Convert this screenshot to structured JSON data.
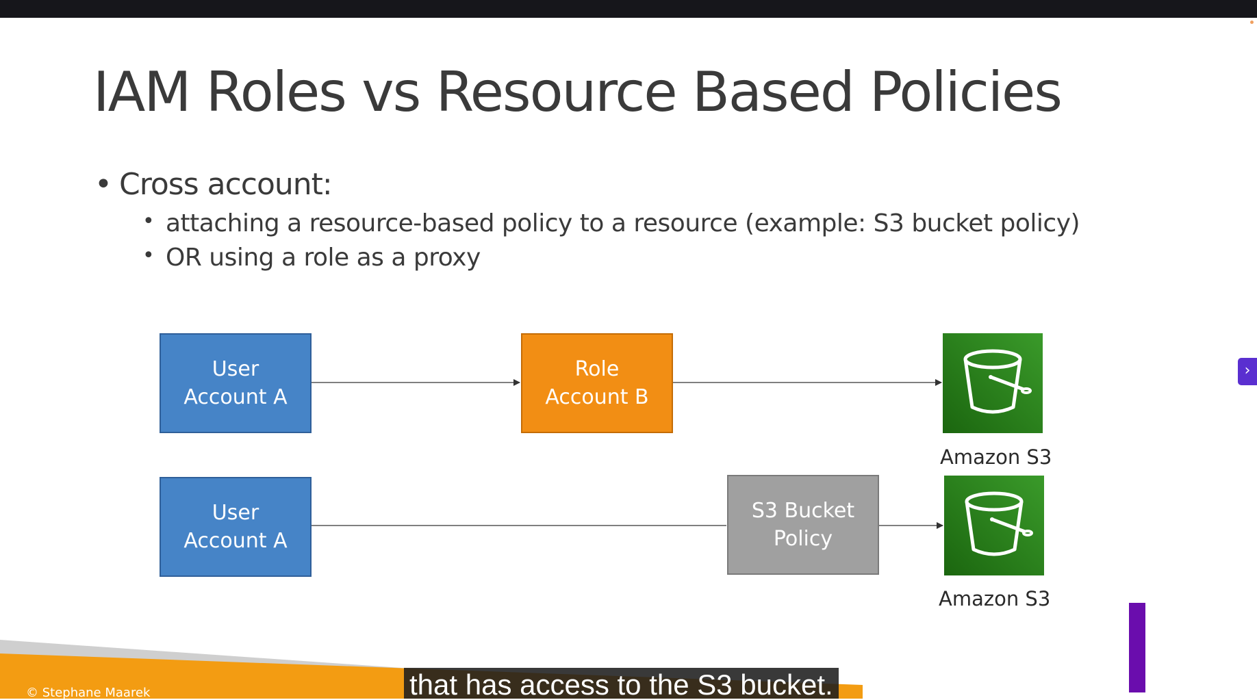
{
  "slide": {
    "title": "IAM Roles vs Resource Based Policies",
    "bullet_main": "Cross account:",
    "sub_bullets": [
      "attaching a resource-based policy to a resource (example: S3 bucket policy)",
      "OR using a role as a proxy"
    ],
    "bullet_glyph": "•"
  },
  "diagram": {
    "row1": {
      "user_box": "User\nAccount A",
      "role_box": "Role\nAccount B",
      "target_label": "Amazon S3"
    },
    "row2": {
      "user_box": "User\nAccount A",
      "policy_box": "S3 Bucket\nPolicy",
      "target_label": "Amazon S3"
    },
    "icons": [
      "s3-bucket-icon"
    ],
    "colors": {
      "user": "#4684c7",
      "role": "#f28e14",
      "policy": "#a0a0a0",
      "s3": "#2e8b1f"
    }
  },
  "footer": {
    "copyright": "© Stephane Maarek",
    "accent": "#f39c12"
  },
  "player": {
    "caption": "that has access to the S3 bucket.",
    "next_glyph": "›"
  }
}
